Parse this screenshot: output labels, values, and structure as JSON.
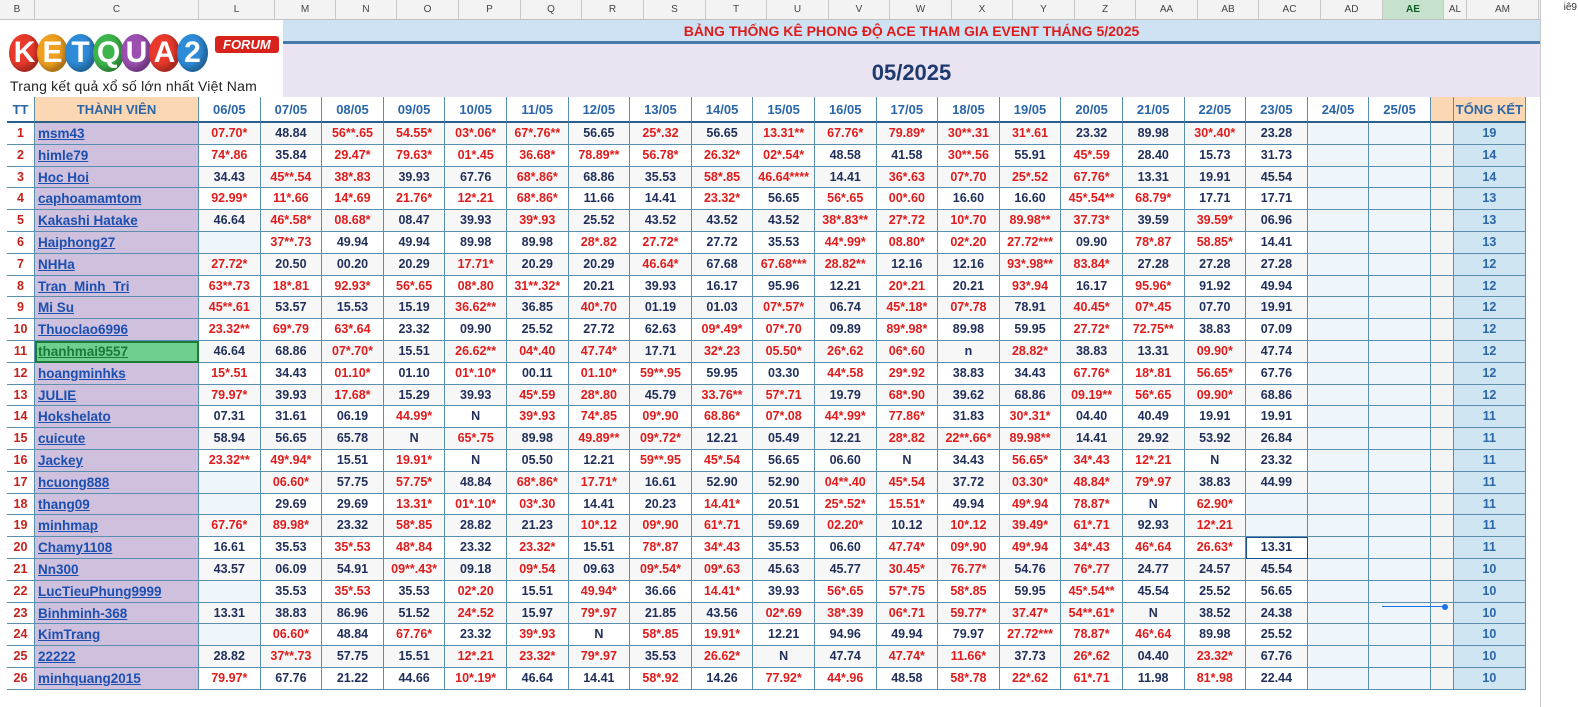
{
  "columns": [
    "B",
    "C",
    "L",
    "M",
    "N",
    "O",
    "P",
    "Q",
    "R",
    "S",
    "T",
    "U",
    "V",
    "W",
    "X",
    "Y",
    "Z",
    "AA",
    "AB",
    "AC",
    "AD",
    "AE",
    "AL",
    "AM"
  ],
  "selected_column": "AE",
  "logo": {
    "letters": [
      "K",
      "E",
      "T",
      "Q",
      "U",
      "A",
      "2"
    ],
    "letter_colors": [
      "#e8392b",
      "#f0a020",
      "#2e8bd8",
      "#3cb54a",
      "#9b4fb0",
      "#e8392b",
      "#2e8bd8"
    ],
    "forum": "FORUM",
    "tagline": "Trang kết quả xổ số lớn nhất Việt Nam"
  },
  "title": "BẢNG THỐNG KÊ PHONG ĐỘ ACE THAM GIA EVENT THÁNG 5/2025",
  "month": "05/2025",
  "right_peek": "iê9",
  "headers": {
    "tt": "TT",
    "member": "THÀNH VIÊN",
    "total": "TỔNG KẾT",
    "days": [
      "06/05",
      "07/05",
      "08/05",
      "09/05",
      "10/05",
      "11/05",
      "12/05",
      "13/05",
      "14/05",
      "15/05",
      "16/05",
      "17/05",
      "18/05",
      "19/05",
      "20/05",
      "21/05",
      "22/05",
      "23/05",
      "24/05",
      "25/05"
    ]
  },
  "rows": [
    {
      "tt": "1",
      "name": "msm43",
      "total": "19",
      "cells": [
        "07.70*",
        "48.84",
        "56**.65",
        "54.55*",
        "03*.06*",
        "67*.76**",
        "56.65",
        "25*.32",
        "56.65",
        "13.31**",
        "67.76*",
        "79.89*",
        "30**.31",
        "31*.61",
        "23.32",
        "89.98",
        "30*.40*",
        "23.28",
        "",
        ""
      ]
    },
    {
      "tt": "2",
      "name": "himle79",
      "total": "14",
      "cells": [
        "74*.86",
        "35.84",
        "29.47*",
        "79.63*",
        "01*.45",
        "36.68*",
        "78.89**",
        "56.78*",
        "26.32*",
        "02*.54*",
        "48.58",
        "41.58",
        "30**.56",
        "55.91",
        "45*.59",
        "28.40",
        "15.73",
        "31.73",
        "",
        ""
      ]
    },
    {
      "tt": "3",
      "name": "Hoc Hoi",
      "total": "14",
      "cells": [
        "34.43",
        "45**.54",
        "38*.83",
        "39.93",
        "67.76",
        "68*.86*",
        "68.86",
        "35.53",
        "58*.85",
        "46.64****",
        "14.41",
        "36*.63",
        "07*.70",
        "25*.52",
        "67.76*",
        "13.31",
        "19.91",
        "45.54",
        "",
        ""
      ]
    },
    {
      "tt": "4",
      "name": "caphoamamtom",
      "total": "13",
      "cells": [
        "92.99*",
        "11*.66",
        "14*.69",
        "21.76*",
        "12*.21",
        "68*.86*",
        "11.66",
        "14.41",
        "23.32*",
        "56.65",
        "56*.65",
        "00*.60",
        "16.60",
        "16.60",
        "45*.54**",
        "68.79*",
        "17.71",
        "17.71",
        "",
        ""
      ]
    },
    {
      "tt": "5",
      "name": "Kakashi Hatake",
      "total": "13",
      "cells": [
        "46.64",
        "46*.58*",
        "08.68*",
        "08.47",
        "39.93",
        "39*.93",
        "25.52",
        "43.52",
        "43.52",
        "43.52",
        "38*.83**",
        "27*.72",
        "10*.70",
        "89.98**",
        "37.73*",
        "39.59",
        "39.59*",
        "06.96",
        "",
        ""
      ]
    },
    {
      "tt": "6",
      "name": "Haiphong27",
      "total": "13",
      "cells": [
        "",
        "37**.73",
        "49.94",
        "49.94",
        "89.98",
        "89.98",
        "28*.82",
        "27.72*",
        "27.72",
        "35.53",
        "44*.99*",
        "08.80*",
        "02*.20",
        "27.72***",
        "09.90",
        "78*.87",
        "58.85*",
        "14.41",
        "",
        ""
      ]
    },
    {
      "tt": "7",
      "name": "NHHa",
      "total": "12",
      "cells": [
        "27.72*",
        "20.50",
        "00.20",
        "20.29",
        "17.71*",
        "20.29",
        "20.29",
        "46.64*",
        "67.68",
        "67.68***",
        "28.82**",
        "12.16",
        "12.16",
        "93*.98**",
        "83.84*",
        "27.28",
        "27.28",
        "27.28",
        "",
        ""
      ]
    },
    {
      "tt": "8",
      "name": "Tran_Minh_Tri",
      "total": "12",
      "cells": [
        "63**.73",
        "18*.81",
        "92.93*",
        "56*.65",
        "08*.80",
        "31**.32*",
        "20.21",
        "39.93",
        "16.17",
        "95.96",
        "12.21",
        "20*.21",
        "20.21",
        "93*.94",
        "16.17",
        "95.96*",
        "91.92",
        "49.94",
        "",
        ""
      ]
    },
    {
      "tt": "9",
      "name": "Mi Su",
      "total": "12",
      "cells": [
        "45**.61",
        "53.57",
        "15.53",
        "15.19",
        "36.62**",
        "36.85",
        "40*.70",
        "01.19",
        "01.03",
        "07*.57*",
        "06.74",
        "45*.18*",
        "07*.78",
        "78.91",
        "40.45*",
        "07*.45",
        "07.70",
        "19.91",
        "",
        ""
      ]
    },
    {
      "tt": "10",
      "name": "Thuoclao6996",
      "total": "12",
      "cells": [
        "23.32**",
        "69*.79",
        "63*.64",
        "23.32",
        "09.90",
        "25.52",
        "27.72",
        "62.63",
        "09*.49*",
        "07*.70",
        "09.89",
        "89*.98*",
        "89.98",
        "59.95",
        "27.72*",
        "72.75**",
        "38.83",
        "07.09",
        "",
        ""
      ]
    },
    {
      "tt": "11",
      "name": "thanhmai9557",
      "total": "12",
      "cells": [
        "46.64",
        "68.86",
        "07*.70*",
        "15.51",
        "26.62**",
        "04*.40",
        "47.74*",
        "17.71",
        "32*.23",
        "05.50*",
        "26*.62",
        "06*.60",
        "n",
        "28.82*",
        "38.83",
        "13.31",
        "09.90*",
        "47.74",
        "",
        ""
      ]
    },
    {
      "tt": "12",
      "name": "hoangminhks",
      "total": "12",
      "cells": [
        "15*.51",
        "34.43",
        "01.10*",
        "01.10",
        "01*.10*",
        "00.11",
        "01.10*",
        "59**.95",
        "59.95",
        "03.30",
        "44*.58",
        "29*.92",
        "38.83",
        "34.43",
        "67.76*",
        "18*.81",
        "56.65*",
        "67.76",
        "",
        ""
      ]
    },
    {
      "tt": "13",
      "name": "JULIE",
      "total": "12",
      "cells": [
        "79.97*",
        "39.93",
        "17.68*",
        "15.29",
        "39.93",
        "45*.59",
        "28*.80",
        "45.79",
        "33.76**",
        "57*.71",
        "19.79",
        "68*.90",
        "39.62",
        "68.86",
        "09.19**",
        "56*.65",
        "09.90*",
        "68.86",
        "",
        ""
      ]
    },
    {
      "tt": "14",
      "name": "Hokshelato",
      "total": "11",
      "cells": [
        "07.31",
        "31.61",
        "06.19",
        "44.99*",
        "N",
        "39*.93",
        "74*.85",
        "09*.90",
        "68.86*",
        "07*.08",
        "44*.99*",
        "77.86*",
        "31.83",
        "30*.31*",
        "04.40",
        "40.49",
        "19.91",
        "19.91",
        "",
        ""
      ]
    },
    {
      "tt": "15",
      "name": "cuicute",
      "total": "11",
      "cells": [
        "58.94",
        "56.65",
        "65.78",
        "N",
        "65*.75",
        "89.98",
        "49.89**",
        "09*.72*",
        "12.21",
        "05.49",
        "12.21",
        "28*.82",
        "22**.66*",
        "89.98**",
        "14.41",
        "29.92",
        "53.92",
        "26.84",
        "",
        ""
      ]
    },
    {
      "tt": "16",
      "name": "Jackey",
      "total": "11",
      "cells": [
        "23.32**",
        "49*.94*",
        "15.51",
        "19.91*",
        "N",
        "05.50",
        "12.21",
        "59**.95",
        "45*.54",
        "56.65",
        "06.60",
        "N",
        "34.43",
        "56.65*",
        "34*.43",
        "12*.21",
        "N",
        "23.32",
        "",
        ""
      ]
    },
    {
      "tt": "17",
      "name": "hcuong888",
      "total": "11",
      "cells": [
        "",
        "06.60*",
        "57.75",
        "57.75*",
        "48.84",
        "68*.86*",
        "17.71*",
        "16.61",
        "52.90",
        "52.90",
        "04**.40",
        "45*.54",
        "37.72",
        "03.30*",
        "48.84*",
        "79*.97",
        "38.83",
        "44.99",
        "",
        ""
      ]
    },
    {
      "tt": "18",
      "name": "thang09",
      "total": "11",
      "cells": [
        "",
        "29.69",
        "29.69",
        "13.31*",
        "01*.10*",
        "03*.30",
        "14.41",
        "20.23",
        "14.41*",
        "20.51",
        "25*.52*",
        "15.51*",
        "49.94",
        "49*.94",
        "78.87*",
        "N",
        "62.90*",
        "",
        "",
        ""
      ]
    },
    {
      "tt": "19",
      "name": "minhmap",
      "total": "11",
      "cells": [
        "67.76*",
        "89.98*",
        "23.32",
        "58*.85",
        "28.82",
        "21.23",
        "10*.12",
        "09*.90",
        "61*.71",
        "59.69",
        "02.20*",
        "10.12",
        "10*.12",
        "39.49*",
        "61*.71",
        "92.93",
        "12*.21",
        "",
        "",
        ""
      ]
    },
    {
      "tt": "20",
      "name": "Chamy1108",
      "total": "11",
      "cells": [
        "16.61",
        "35.53",
        "35*.53",
        "48*.84",
        "23.32",
        "23.32*",
        "15.51",
        "78*.87",
        "34*.43",
        "35.53",
        "06.60",
        "47.74*",
        "09*.90",
        "49*.94",
        "34*.43",
        "46*.64",
        "26.63*",
        "13.31",
        "",
        ""
      ]
    },
    {
      "tt": "21",
      "name": "Nn300",
      "total": "10",
      "cells": [
        "43.57",
        "06.09",
        "54.91",
        "09**.43*",
        "09.18",
        "09*.54",
        "09.63",
        "09*.54*",
        "09*.63",
        "45.63",
        "45.77",
        "30.45*",
        "76.77*",
        "54.76",
        "76*.77",
        "24.77",
        "24.57",
        "45.54",
        "",
        ""
      ]
    },
    {
      "tt": "22",
      "name": "LucTieuPhung9999",
      "total": "10",
      "cells": [
        "",
        "35.53",
        "35*.53",
        "35.53",
        "02*.20",
        "15.51",
        "49.94*",
        "36.66",
        "14.41*",
        "39.93",
        "56*.65",
        "57*.75",
        "58*.85",
        "59.95",
        "45*.54**",
        "45.54",
        "25.52",
        "56.65",
        "",
        ""
      ]
    },
    {
      "tt": "23",
      "name": "Binhminh-368",
      "total": "10",
      "cells": [
        "13.31",
        "38.83",
        "86.96",
        "51.52",
        "24*.52",
        "15.97",
        "79*.97",
        "21.85",
        "43.56",
        "02*.69",
        "38*.39",
        "06*.71",
        "59.77*",
        "37.47*",
        "54**.61*",
        "N",
        "38.52",
        "24.38",
        "",
        ""
      ]
    },
    {
      "tt": "24",
      "name": "KimTrang",
      "total": "10",
      "cells": [
        "",
        "06.60*",
        "48.84",
        "67.76*",
        "23.32",
        "39*.93",
        "N",
        "58*.85",
        "19.91*",
        "12.21",
        "94.96",
        "49.94",
        "79.97",
        "27.72***",
        "78.87*",
        "46*.64",
        "89.98",
        "25.52",
        "",
        ""
      ]
    },
    {
      "tt": "25",
      "name": "22222",
      "total": "10",
      "cells": [
        "28.82",
        "37**.73",
        "57.75",
        "15.51",
        "12*.21",
        "23.32*",
        "79*.97",
        "35.53",
        "26.62*",
        "N",
        "47.74",
        "47.74*",
        "11.66*",
        "37.73",
        "26*.62",
        "04.40",
        "23.32*",
        "67.76",
        "",
        ""
      ]
    },
    {
      "tt": "26",
      "name": "minhquang2015",
      "total": "10",
      "cells": [
        "79.97*",
        "67.76",
        "21.22",
        "44.66",
        "10*.19*",
        "46.64",
        "14.41",
        "58*.92",
        "14.26",
        "77.92*",
        "44*.96",
        "48.58",
        "58*.78",
        "22*.62",
        "61*.71",
        "11.98",
        "81*.98",
        "22.44",
        "",
        ""
      ]
    }
  ]
}
